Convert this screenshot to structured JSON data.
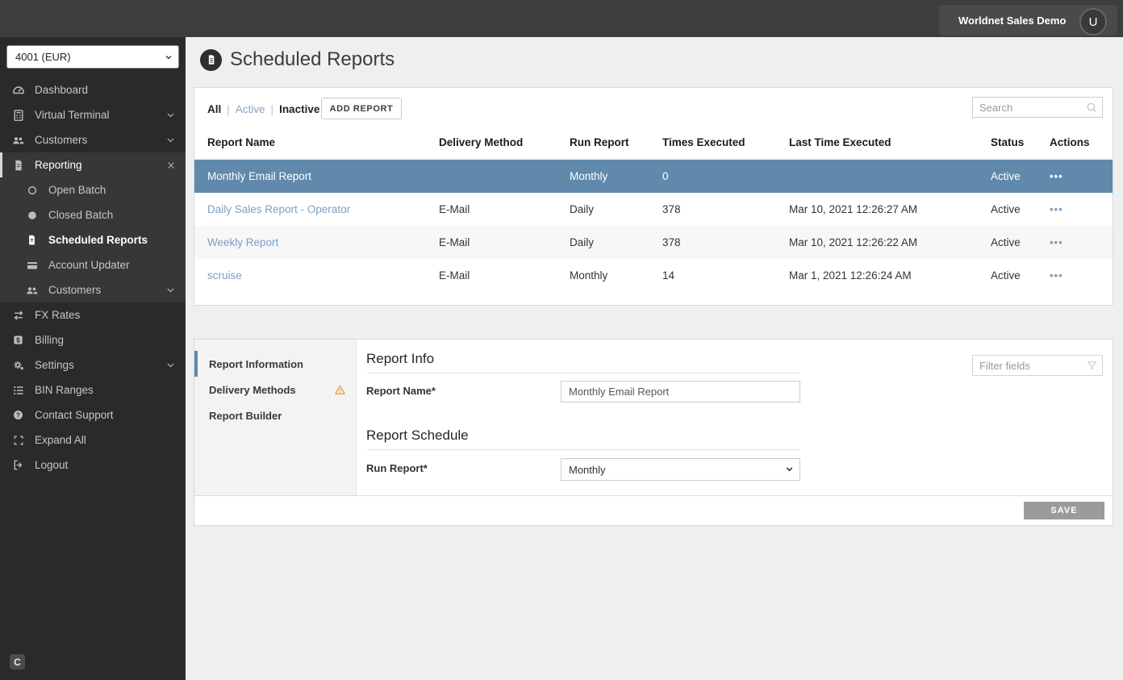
{
  "topbar": {
    "account_label": "Worldnet Sales Demo",
    "avatar_initial": "U"
  },
  "sidebar": {
    "terminal_select": {
      "value": "4001 (EUR)"
    },
    "items": [
      {
        "label": "Dashboard",
        "icon": "dashboard-icon"
      },
      {
        "label": "Virtual Terminal",
        "icon": "calculator-icon",
        "chevron": true
      },
      {
        "label": "Customers",
        "icon": "customers-icon",
        "chevron": true
      },
      {
        "label": "Reporting",
        "icon": "report-icon",
        "close": true,
        "expanded": true
      },
      {
        "label": "Open Batch",
        "icon": "open-circle-icon",
        "sub": true
      },
      {
        "label": "Closed Batch",
        "icon": "filled-circle-icon",
        "sub": true
      },
      {
        "label": "Scheduled Reports",
        "icon": "document-icon",
        "sub": true,
        "active": true
      },
      {
        "label": "Account Updater",
        "icon": "card-icon",
        "sub": true
      },
      {
        "label": "Customers",
        "icon": "customers-icon",
        "sub": true,
        "chevron": true
      },
      {
        "label": "FX Rates",
        "icon": "fx-swap-icon"
      },
      {
        "label": "Billing",
        "icon": "billing-icon"
      },
      {
        "label": "Settings",
        "icon": "settings-icon",
        "chevron": true
      },
      {
        "label": "BIN Ranges",
        "icon": "list-icon"
      },
      {
        "label": "Contact Support",
        "icon": "help-icon"
      },
      {
        "label": "Expand All",
        "icon": "expand-icon"
      },
      {
        "label": "Logout",
        "icon": "logout-icon"
      }
    ],
    "cookie_badge": "C"
  },
  "page": {
    "title": "Scheduled Reports"
  },
  "toolbar": {
    "filters": {
      "all": "All",
      "active": "Active",
      "inactive": "Inactive"
    },
    "separator": "|",
    "selected_filter": "All",
    "add_button": "ADD REPORT",
    "search_placeholder": "Search"
  },
  "table": {
    "columns": [
      "Report Name",
      "Delivery Method",
      "Run Report",
      "Times Executed",
      "Last Time Executed",
      "Status",
      "Actions"
    ],
    "actions_glyph": "•••",
    "rows": [
      {
        "name": "Monthly Email Report",
        "delivery": "",
        "run": "Monthly",
        "times": "0",
        "last": "",
        "status": "Active",
        "selected": true
      },
      {
        "name": "Daily Sales Report - Operator",
        "delivery": "E-Mail",
        "run": "Daily",
        "times": "378",
        "last": "Mar 10, 2021 12:26:27 AM",
        "status": "Active",
        "selected": false
      },
      {
        "name": "Weekly Report",
        "delivery": "E-Mail",
        "run": "Daily",
        "times": "378",
        "last": "Mar 10, 2021 12:26:22 AM",
        "status": "Active",
        "selected": false
      },
      {
        "name": "scruise",
        "delivery": "E-Mail",
        "run": "Monthly",
        "times": "14",
        "last": "Mar 1, 2021 12:26:24 AM",
        "status": "Active",
        "selected": false
      }
    ]
  },
  "detail": {
    "tabs": [
      {
        "label": "Report Information",
        "active": true
      },
      {
        "label": "Delivery Methods",
        "warning": true
      },
      {
        "label": "Report Builder"
      }
    ],
    "filter_placeholder": "Filter fields",
    "sections": {
      "info_title": "Report Info",
      "schedule_title": "Report Schedule"
    },
    "fields": {
      "report_name_label": "Report Name*",
      "report_name_value": "Monthly Email Report",
      "run_report_label": "Run Report*",
      "run_report_value": "Monthly"
    },
    "save_label": "SAVE"
  },
  "colors": {
    "selected_row": "#6089ab",
    "link": "#7ba0c2",
    "accent_bar": "#5e8aac",
    "warning": "#e8a33d",
    "sidebar_bg": "#2a2a2b",
    "topbar_bg": "#3d3d3e"
  }
}
